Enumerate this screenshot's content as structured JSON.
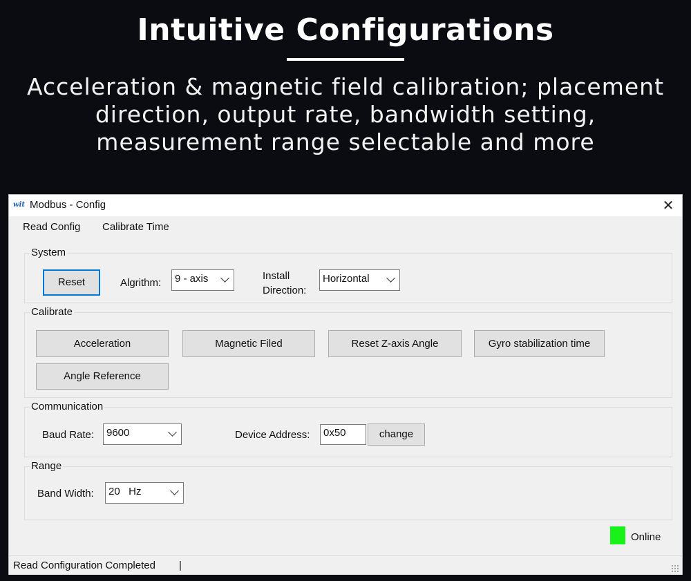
{
  "hero": {
    "title": "Intuitive Configurations",
    "subtitle_lines": [
      "Acceleration & magnetic field calibration; placement",
      "direction, output rate, bandwidth setting,",
      "measurement range selectable and more"
    ]
  },
  "window": {
    "title": "Modbus - Config",
    "close_symbol": "✕",
    "icon_text": "wit"
  },
  "menu": {
    "items": [
      "Read Config",
      "Calibrate Time"
    ]
  },
  "system": {
    "title": "System",
    "reset_label": "Reset",
    "algorithm_label": "Algrithm:",
    "algorithm_value": "9 - axis",
    "install_label_line1": "Install",
    "install_label_line2": "Direction:",
    "install_value": "Horizontal"
  },
  "calibrate": {
    "title": "Calibrate",
    "buttons": [
      "Acceleration",
      "Magnetic Filed",
      "Reset Z-axis Angle",
      "Gyro stabilization time",
      "Angle Reference"
    ]
  },
  "communication": {
    "title": "Communication",
    "baud_label": "Baud Rate:",
    "baud_value": "9600",
    "address_label": "Device Address:",
    "address_value": "0x50",
    "change_label": "change"
  },
  "range": {
    "title": "Range",
    "bandwidth_label": "Band Width:",
    "bandwidth_value": "20   Hz"
  },
  "status": {
    "online_label": "Online",
    "online_color": "#19f219",
    "message": "Read Configuration Completed",
    "separator": "|"
  },
  "icons": [
    "app-logo-icon",
    "close-icon",
    "chevron-down-icon",
    "status-led-icon",
    "resize-grip-icon"
  ]
}
